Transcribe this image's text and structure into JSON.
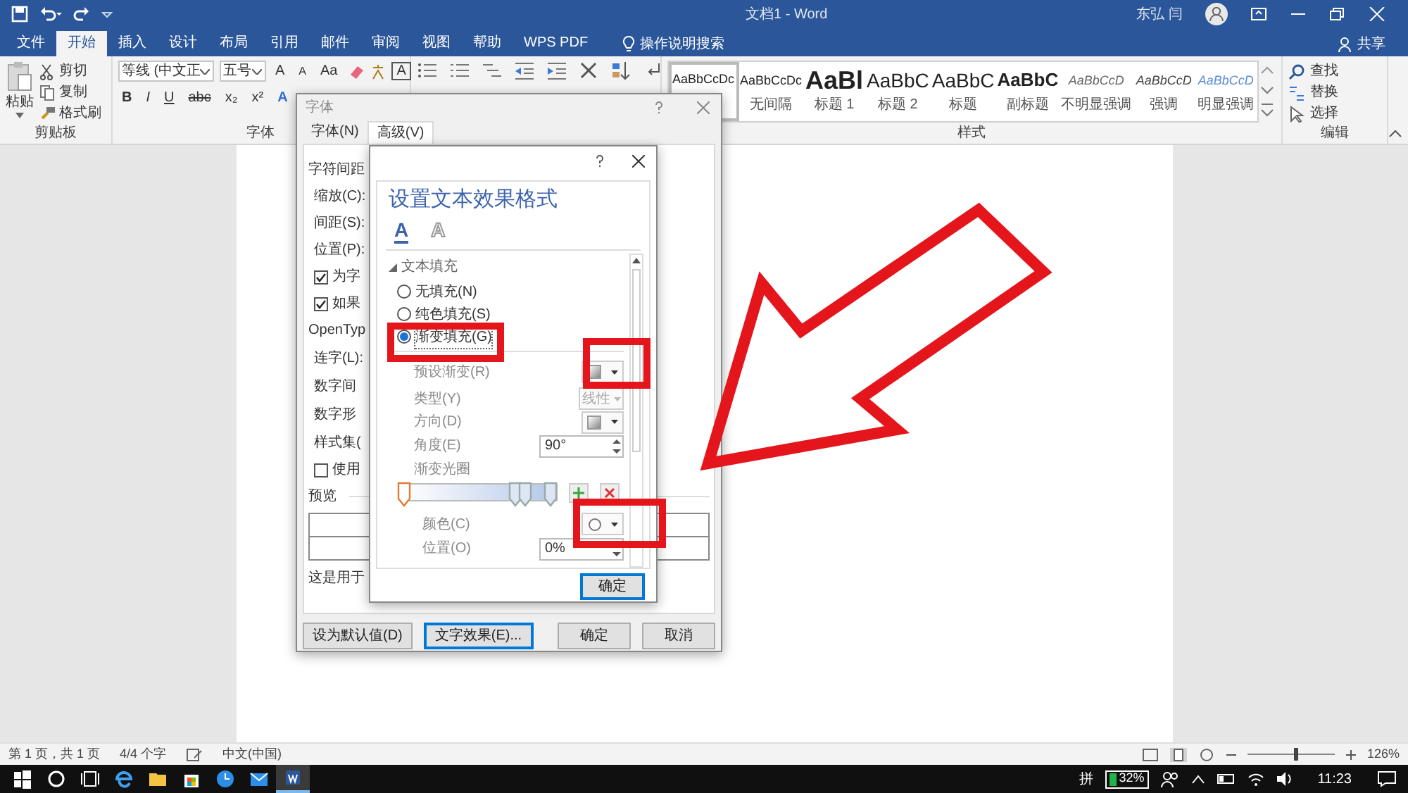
{
  "title_bar": {
    "title": "文档1 - Word",
    "user": "东弘 闫"
  },
  "ribbon_tabs": [
    {
      "label": "文件",
      "selected": false
    },
    {
      "label": "开始",
      "selected": true
    },
    {
      "label": "插入",
      "selected": false
    },
    {
      "label": "设计",
      "selected": false
    },
    {
      "label": "布局",
      "selected": false
    },
    {
      "label": "引用",
      "selected": false
    },
    {
      "label": "邮件",
      "selected": false
    },
    {
      "label": "审阅",
      "selected": false
    },
    {
      "label": "视图",
      "selected": false
    },
    {
      "label": "帮助",
      "selected": false
    },
    {
      "label": "WPS PDF",
      "selected": false
    }
  ],
  "tell_me": "操作说明搜索",
  "share": "共享",
  "clipboard": {
    "paste": "粘贴",
    "actions": [
      "剪切",
      "复制",
      "格式刷"
    ],
    "label": "剪贴板"
  },
  "font": {
    "name": "等线 (中文正",
    "size": "五号",
    "grow": "A",
    "shrink": "A",
    "case": "Aa",
    "border_char": "A",
    "format": [
      "B",
      "I",
      "U",
      "abc",
      "x₂",
      "x²"
    ],
    "effects": "A",
    "label": "字体"
  },
  "styles": {
    "items": [
      {
        "kind": "normal",
        "sample": "AaBbCcDc"
      },
      {
        "kind": "normal",
        "sample": "AaBbCcDc",
        "name": "无间隔"
      },
      {
        "kind": "heading1",
        "sample": "AaBl",
        "name": "标题 1"
      },
      {
        "kind": "heading2",
        "sample": "AaBbC",
        "name": "标题 2"
      },
      {
        "kind": "title",
        "sample": "AaBbC",
        "name": "标题"
      },
      {
        "kind": "subtitle",
        "sample": "AaBbC",
        "name": "副标题"
      },
      {
        "kind": "subtle",
        "sample": "AaBbCcD",
        "name": "不明显强调"
      },
      {
        "kind": "emphasis",
        "sample": "AaBbCcD",
        "name": "强调"
      },
      {
        "kind": "intense",
        "sample": "AaBbCcD",
        "name": "明显强调"
      }
    ],
    "label": "样式"
  },
  "editing": {
    "actions": [
      "查找",
      "替换",
      "选择"
    ],
    "label": "编辑"
  },
  "font_dialog": {
    "title": "字体",
    "tabs": [
      {
        "label": "字体(N)",
        "selected": false
      },
      {
        "label": "高级(V)",
        "selected": true
      }
    ],
    "spacing_heading": "字符间距",
    "spacing_labels": [
      "缩放(C):",
      "间距(S):",
      "位置(P):"
    ],
    "checks_1": [
      {
        "label": "为字",
        "checked": true
      },
      {
        "label": "如果",
        "checked": true
      }
    ],
    "opentype_heading": "OpenTyp",
    "opentype_labels": [
      "连字(L):",
      "数字间",
      "数字形",
      "样式集("
    ],
    "checks_2": [
      {
        "label": "使用",
        "checked": false
      }
    ],
    "preview_heading": "预览",
    "preview_note": "这是用于",
    "buttons": [
      "设为默认值(D)",
      "文字效果(E)...",
      "确定",
      "取消"
    ]
  },
  "effects_dialog": {
    "heading": "设置文本效果格式",
    "icon_tabs": [
      {
        "label": "A",
        "selected": true
      },
      {
        "label": "A",
        "selected": false
      }
    ],
    "section": {
      "label": "文本填充",
      "expanded": true
    },
    "fill_options": [
      {
        "label": "无填充(N)",
        "selected": false
      },
      {
        "label": "纯色填充(S)",
        "selected": false
      },
      {
        "label": "渐变填充(G)",
        "selected": true
      }
    ],
    "preset_label": "预设渐变(R)",
    "type_label": "类型(Y)",
    "type_value": "线性",
    "type_disabled": true,
    "direction_label": "方向(D)",
    "angle_label": "角度(E)",
    "angle_value": "90°",
    "stops_label": "渐变光圈",
    "stops": [
      {
        "level": 0.0,
        "selected": true
      },
      {
        "level": 0.73,
        "selected": false
      },
      {
        "level": 0.8,
        "selected": false
      },
      {
        "level": 0.96,
        "selected": false
      }
    ],
    "color_label": "颜色(C)",
    "position_label": "位置(O)",
    "position_value": "0%",
    "ok": "确定"
  },
  "status_bar": {
    "page": "第 1 页，共 1 页",
    "words": "4/4 个字",
    "language": "中文(中国)",
    "zoom": "126%",
    "zoom_slider": {
      "level": 0.55
    }
  },
  "taskbar": {
    "ime": "拼",
    "battery": "32%",
    "time": "11:23"
  }
}
